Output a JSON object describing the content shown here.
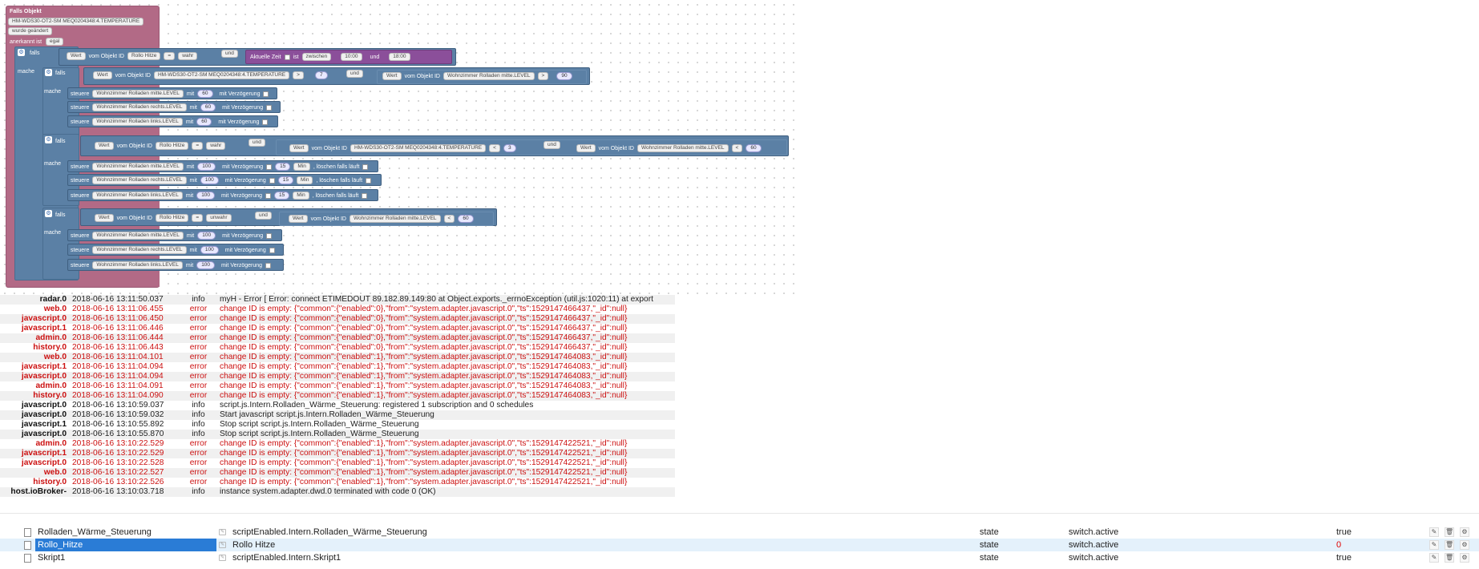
{
  "blockly": {
    "trigger": {
      "title": "Falls Objekt",
      "object_id": "HM-WDS30-OT2-SM MEQ0204348:4.TEMPERATURE",
      "changed": "wurde geändert",
      "ack_label": "anerkannt ist",
      "ack_value": "egal"
    },
    "words": {
      "if": "falls",
      "do": "mache",
      "value": "Wert",
      "of_object": "vom Objekt ID",
      "and": "und",
      "current_time": "Aktuelle Zeit",
      "is": "ist",
      "between": "zwischen",
      "and_time": "und",
      "control": "steuere",
      "with": "mit",
      "with_delay": "mit Verzögerung",
      "min": "Min",
      "clear_running": ", löschen falls läuft"
    },
    "if1": {
      "obj": "Rollo Hitze",
      "op": "=",
      "val": "wahr",
      "time_from": "10:00",
      "time_to": "18:00",
      "inner_if": {
        "obj": "HM-WDS30-OT2-SM MEQ0204348:4.TEMPERATURE",
        "op": ">",
        "num": "7",
        "obj2": "Wohnzimmer Rolladen mitte.LEVEL",
        "op2": ">",
        "num2": "90"
      },
      "actions": [
        {
          "target": "Wohnzimmer Rolladen mitte.LEVEL",
          "value": "60"
        },
        {
          "target": "Wohnzimmer Rolladen rechts.LEVEL",
          "value": "60"
        },
        {
          "target": "Wohnzimmer Rolladen links.LEVEL",
          "value": "60"
        }
      ]
    },
    "if2": {
      "obj": "Rollo Hitze",
      "op": "=",
      "val": "wahr",
      "obj2": "HM-WDS30-OT2-SM MEQ0204348:4.TEMPERATURE",
      "op2": "<",
      "num2": "3",
      "obj3": "Wohnzimmer Rolladen mitte.LEVEL",
      "op3": "<",
      "num3": "60",
      "actions": [
        {
          "target": "Wohnzimmer Rolladen mitte.LEVEL",
          "value": "100",
          "delay": "15"
        },
        {
          "target": "Wohnzimmer Rolladen rechts.LEVEL",
          "value": "100",
          "delay": "15"
        },
        {
          "target": "Wohnzimmer Rolladen links.LEVEL",
          "value": "100",
          "delay": "15"
        }
      ]
    },
    "if3": {
      "obj": "Rollo Hitze",
      "op": "=",
      "val": "unwahr",
      "obj2": "Wohnzimmer Rolladen mitte.LEVEL",
      "op2": "<",
      "num2": "60",
      "actions": [
        {
          "target": "Wohnzimmer Rolladen mitte.LEVEL",
          "value": "100"
        },
        {
          "target": "Wohnzimmer Rolladen rechts.LEVEL",
          "value": "100"
        },
        {
          "target": "Wohnzimmer Rolladen links.LEVEL",
          "value": "100"
        }
      ]
    }
  },
  "log": [
    {
      "src": "radar.0",
      "time": "2018-06-16 13:11:50.037",
      "sev": "info",
      "msg": "myH - Error [ Error: connect ETIMEDOUT 89.182.89.149:80 at Object.exports._errnoException (util.js:1020:11) at export"
    },
    {
      "src": "web.0",
      "time": "2018-06-16 13:11:06.455",
      "sev": "error",
      "msg": "change ID is empty: {\"common\":{\"enabled\":0},\"from\":\"system.adapter.javascript.0\",\"ts\":1529147466437,\"_id\":null}"
    },
    {
      "src": "javascript.0",
      "time": "2018-06-16 13:11:06.450",
      "sev": "error",
      "msg": "change ID is empty: {\"common\":{\"enabled\":0},\"from\":\"system.adapter.javascript.0\",\"ts\":1529147466437,\"_id\":null}"
    },
    {
      "src": "javascript.1",
      "time": "2018-06-16 13:11:06.446",
      "sev": "error",
      "msg": "change ID is empty: {\"common\":{\"enabled\":0},\"from\":\"system.adapter.javascript.0\",\"ts\":1529147466437,\"_id\":null}"
    },
    {
      "src": "admin.0",
      "time": "2018-06-16 13:11:06.444",
      "sev": "error",
      "msg": "change ID is empty: {\"common\":{\"enabled\":0},\"from\":\"system.adapter.javascript.0\",\"ts\":1529147466437,\"_id\":null}"
    },
    {
      "src": "history.0",
      "time": "2018-06-16 13:11:06.443",
      "sev": "error",
      "msg": "change ID is empty: {\"common\":{\"enabled\":0},\"from\":\"system.adapter.javascript.0\",\"ts\":1529147466437,\"_id\":null}"
    },
    {
      "src": "web.0",
      "time": "2018-06-16 13:11:04.101",
      "sev": "error",
      "msg": "change ID is empty: {\"common\":{\"enabled\":1},\"from\":\"system.adapter.javascript.0\",\"ts\":1529147464083,\"_id\":null}"
    },
    {
      "src": "javascript.1",
      "time": "2018-06-16 13:11:04.094",
      "sev": "error",
      "msg": "change ID is empty: {\"common\":{\"enabled\":1},\"from\":\"system.adapter.javascript.0\",\"ts\":1529147464083,\"_id\":null}"
    },
    {
      "src": "javascript.0",
      "time": "2018-06-16 13:11:04.094",
      "sev": "error",
      "msg": "change ID is empty: {\"common\":{\"enabled\":1},\"from\":\"system.adapter.javascript.0\",\"ts\":1529147464083,\"_id\":null}"
    },
    {
      "src": "admin.0",
      "time": "2018-06-16 13:11:04.091",
      "sev": "error",
      "msg": "change ID is empty: {\"common\":{\"enabled\":1},\"from\":\"system.adapter.javascript.0\",\"ts\":1529147464083,\"_id\":null}"
    },
    {
      "src": "history.0",
      "time": "2018-06-16 13:11:04.090",
      "sev": "error",
      "msg": "change ID is empty: {\"common\":{\"enabled\":1},\"from\":\"system.adapter.javascript.0\",\"ts\":1529147464083,\"_id\":null}"
    },
    {
      "src": "javascript.0",
      "time": "2018-06-16 13:10:59.037",
      "sev": "info",
      "msg": "script.js.Intern.Rolladen_Wärme_Steuerung: registered 1 subscription and 0 schedules"
    },
    {
      "src": "javascript.0",
      "time": "2018-06-16 13:10:59.032",
      "sev": "info",
      "msg": "Start javascript script.js.Intern.Rolladen_Wärme_Steuerung"
    },
    {
      "src": "javascript.1",
      "time": "2018-06-16 13:10:55.892",
      "sev": "info",
      "msg": "Stop script script.js.Intern.Rolladen_Wärme_Steuerung"
    },
    {
      "src": "javascript.0",
      "time": "2018-06-16 13:10:55.870",
      "sev": "info",
      "msg": "Stop script script.js.Intern.Rolladen_Wärme_Steuerung"
    },
    {
      "src": "admin.0",
      "time": "2018-06-16 13:10:22.529",
      "sev": "error",
      "msg": "change ID is empty: {\"common\":{\"enabled\":1},\"from\":\"system.adapter.javascript.0\",\"ts\":1529147422521,\"_id\":null}"
    },
    {
      "src": "javascript.1",
      "time": "2018-06-16 13:10:22.529",
      "sev": "error",
      "msg": "change ID is empty: {\"common\":{\"enabled\":1},\"from\":\"system.adapter.javascript.0\",\"ts\":1529147422521,\"_id\":null}"
    },
    {
      "src": "javascript.0",
      "time": "2018-06-16 13:10:22.528",
      "sev": "error",
      "msg": "change ID is empty: {\"common\":{\"enabled\":1},\"from\":\"system.adapter.javascript.0\",\"ts\":1529147422521,\"_id\":null}"
    },
    {
      "src": "web.0",
      "time": "2018-06-16 13:10:22.527",
      "sev": "error",
      "msg": "change ID is empty: {\"common\":{\"enabled\":1},\"from\":\"system.adapter.javascript.0\",\"ts\":1529147422521,\"_id\":null}"
    },
    {
      "src": "history.0",
      "time": "2018-06-16 13:10:22.526",
      "sev": "error",
      "msg": "change ID is empty: {\"common\":{\"enabled\":1},\"from\":\"system.adapter.javascript.0\",\"ts\":1529147422521,\"_id\":null}"
    },
    {
      "src": "host.ioBroker-",
      "time": "2018-06-16 13:10:03.718",
      "sev": "info",
      "msg": "instance system.adapter.dwd.0 terminated with code 0 (OK)"
    }
  ],
  "objects": [
    {
      "name": "Rolladen_Wärme_Steuerung",
      "id": "scriptEnabled.Intern.Rolladen_Wärme_Steuerung",
      "type": "state",
      "role": "switch.active",
      "value": "true"
    },
    {
      "name": "Rollo_Hitze",
      "id": "Rollo Hitze",
      "type": "state",
      "role": "switch.active",
      "value": "0"
    },
    {
      "name": "Skript1",
      "id": "scriptEnabled.Intern.Skript1",
      "type": "state",
      "role": "switch.active",
      "value": "true"
    }
  ],
  "colors": {
    "trigger_block": "#b26a86",
    "logic_block": "#5b80a5",
    "time_block": "#8b4f9a",
    "log_error": "#cc1111",
    "selection": "#2a7cd6",
    "value_zero": "#e00000"
  }
}
